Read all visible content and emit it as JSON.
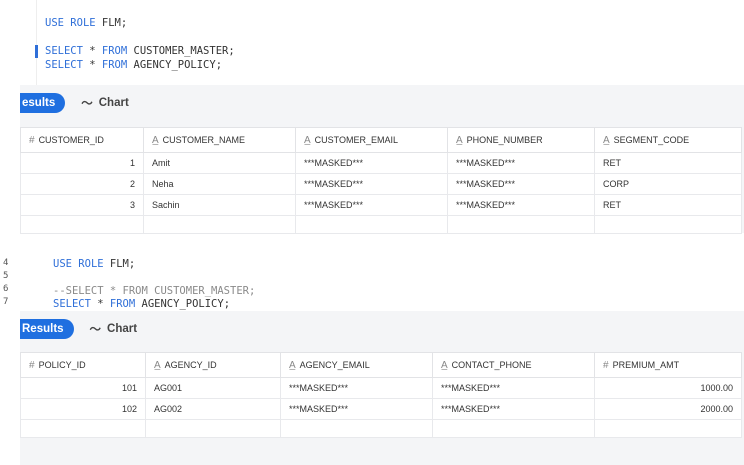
{
  "editor1": {
    "lines": [
      "USE ROLE FLM;",
      "SELECT * FROM CUSTOMER_MASTER;",
      "SELECT * FROM AGENCY_POLICY;"
    ]
  },
  "panel1": {
    "tabs": {
      "results": "esults",
      "chart": "Chart"
    },
    "columns": [
      {
        "name": "CUSTOMER_ID",
        "type": "number-icon"
      },
      {
        "name": "CUSTOMER_NAME",
        "type": "text-icon"
      },
      {
        "name": "CUSTOMER_EMAIL",
        "type": "text-icon"
      },
      {
        "name": "PHONE_NUMBER",
        "type": "text-icon"
      },
      {
        "name": "SEGMENT_CODE",
        "type": "text-icon"
      }
    ],
    "rows": [
      [
        "1",
        "Amit",
        "***MASKED***",
        "***MASKED***",
        "RET"
      ],
      [
        "2",
        "Neha",
        "***MASKED***",
        "***MASKED***",
        "CORP"
      ],
      [
        "3",
        "Sachin",
        "***MASKED***",
        "***MASKED***",
        "RET"
      ]
    ]
  },
  "editor2": {
    "line_numbers": [
      "4",
      "5",
      "6",
      "7"
    ],
    "lines": [
      "USE ROLE FLM;",
      "--SELECT * FROM CUSTOMER_MASTER;",
      "SELECT * FROM AGENCY_POLICY;"
    ]
  },
  "panel2": {
    "tabs": {
      "results": "Results",
      "chart": "Chart"
    },
    "columns": [
      {
        "name": "POLICY_ID",
        "type": "number-icon"
      },
      {
        "name": "AGENCY_ID",
        "type": "text-icon"
      },
      {
        "name": "AGENCY_EMAIL",
        "type": "text-icon"
      },
      {
        "name": "CONTACT_PHONE",
        "type": "text-icon"
      },
      {
        "name": "PREMIUM_AMT",
        "type": "number-icon"
      }
    ],
    "rows": [
      [
        "101",
        "AG001",
        "***MASKED***",
        "***MASKED***",
        "1000.00"
      ],
      [
        "102",
        "AG002",
        "***MASKED***",
        "***MASKED***",
        "2000.00"
      ]
    ]
  }
}
